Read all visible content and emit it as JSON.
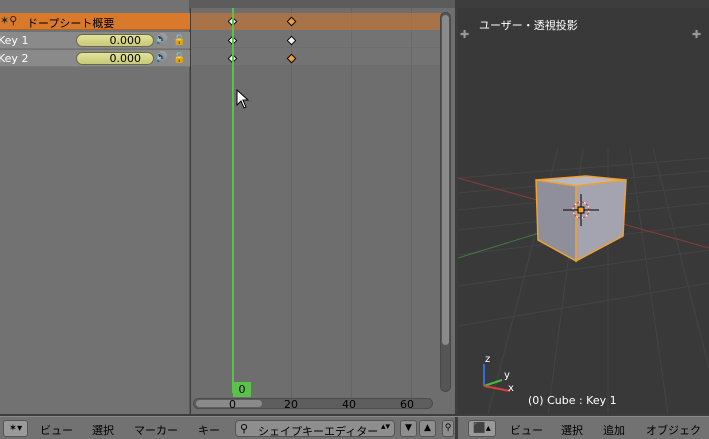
{
  "dopesheet": {
    "summary_label": "ドープシート概要",
    "channels": [
      {
        "name": "Key 1",
        "value": "0.000"
      },
      {
        "name": "Key 2",
        "value": "0.000"
      }
    ],
    "current_frame": "0",
    "ruler_labels": [
      "0",
      "20",
      "40",
      "60"
    ]
  },
  "header": {
    "menus": [
      "ビュー",
      "選択",
      "マーカー",
      "キー"
    ],
    "mode": "シェイプキーエディター",
    "viewport_menus": [
      "ビュー",
      "選択",
      "追加",
      "オブジェク"
    ]
  },
  "viewport": {
    "title": "ユーザー・透視投影",
    "status": "(0) Cube : Key 1",
    "axis_labels": [
      "z",
      "y",
      "x"
    ]
  },
  "colors": {
    "summary": "#d9792c",
    "playhead": "#5ac24a",
    "selection": "#f0a030"
  }
}
